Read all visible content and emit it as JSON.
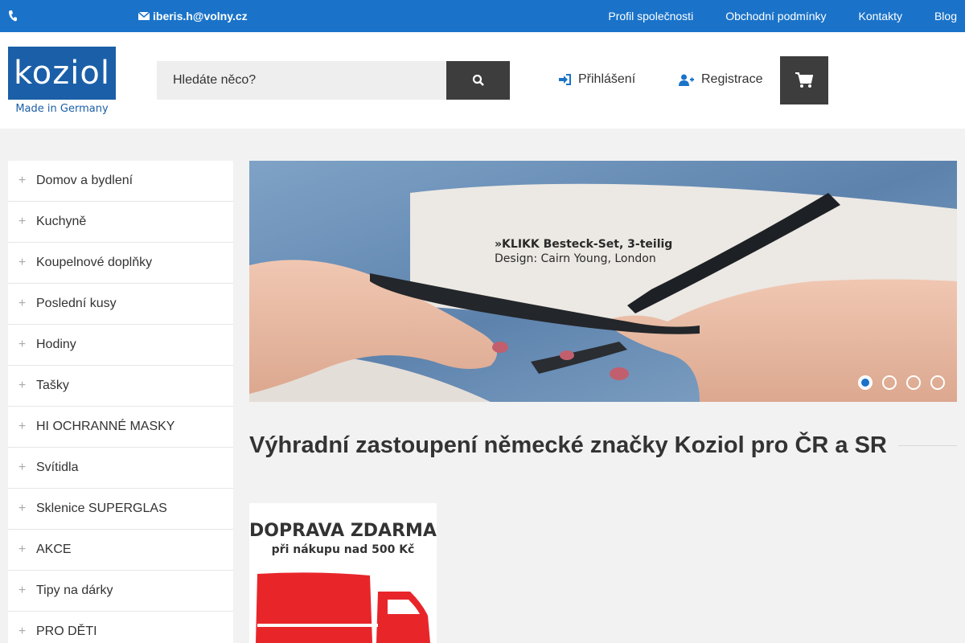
{
  "topbar": {
    "email": "iberis.h@volny.cz",
    "links": [
      "Profil společnosti",
      "Obchodní podmínky",
      "Kontakty",
      "Blog"
    ]
  },
  "logo": {
    "name": "koziol",
    "tagline": "Made in Germany"
  },
  "search": {
    "placeholder": "Hledáte něco?"
  },
  "account": {
    "login": "Přihlášení",
    "register": "Registrace"
  },
  "sidebar": {
    "items": [
      {
        "label": "Domov a bydlení"
      },
      {
        "label": "Kuchyně"
      },
      {
        "label": "Koupelnové doplňky"
      },
      {
        "label": "Poslední kusy"
      },
      {
        "label": "Hodiny"
      },
      {
        "label": "Tašky"
      },
      {
        "label": "HI OCHRANNÉ MASKY"
      },
      {
        "label": "Svítidla"
      },
      {
        "label": "Sklenice SUPERGLAS"
      },
      {
        "label": "AKCE"
      },
      {
        "label": "Tipy na dárky"
      },
      {
        "label": "PRO DĚTI"
      }
    ]
  },
  "banner": {
    "caption_title": "»KLIKK Besteck-Set, 3-teilig",
    "caption_sub": "Design: Cairn Young, London",
    "slides": 4,
    "active_slide": 1
  },
  "main": {
    "headline": "Výhradní zastoupení německé značky Koziol pro ČR a SR"
  },
  "promo": {
    "line1": "DOPRAVA ZDARMA",
    "line2": "při nákupu nad 500 Kč"
  },
  "colors": {
    "topbar": "#1a73c9",
    "logo": "#1a5fa8",
    "dark_button": "#3d3d3d",
    "promo_red": "#e8262a"
  }
}
